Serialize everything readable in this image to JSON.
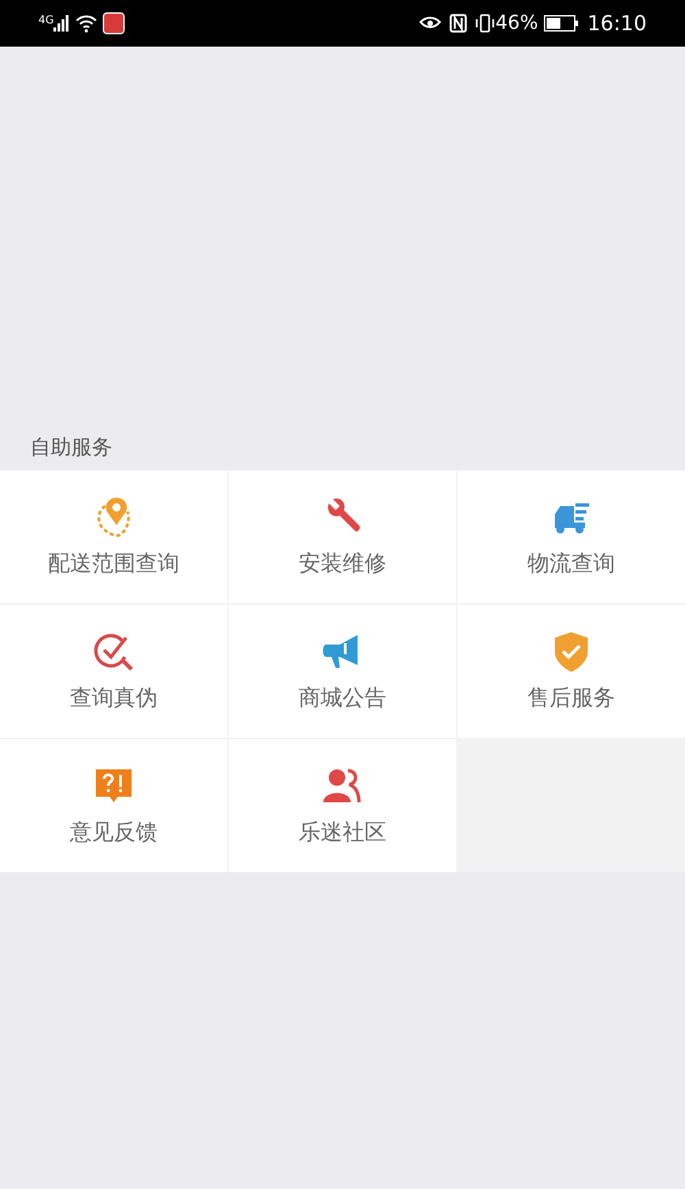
{
  "status_bar": {
    "network": "4G",
    "battery": "46%",
    "time": "16:10"
  },
  "section": {
    "title": "自助服务",
    "items": [
      {
        "label": "配送范围查询"
      },
      {
        "label": "安装维修"
      },
      {
        "label": "物流查询"
      },
      {
        "label": "查询真伪"
      },
      {
        "label": "商城公告"
      },
      {
        "label": "售后服务"
      },
      {
        "label": "意见反馈"
      },
      {
        "label": "乐迷社区"
      }
    ]
  }
}
